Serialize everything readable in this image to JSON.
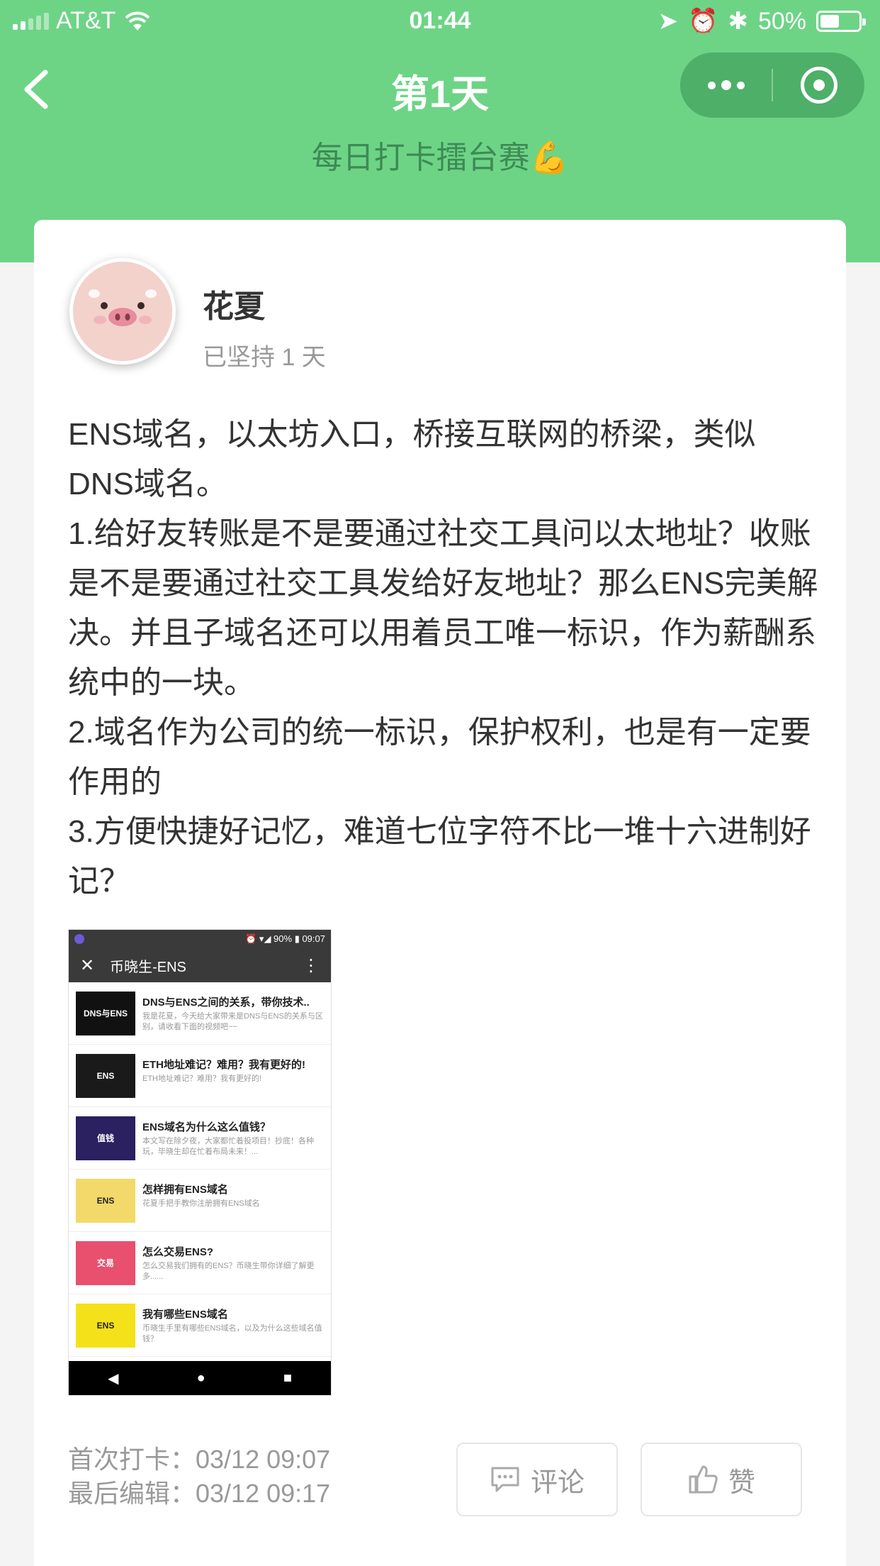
{
  "status_bar": {
    "carrier": "AT&T",
    "time": "01:44",
    "battery": "50%",
    "battery_level": 0.5
  },
  "nav": {
    "title": "第1天",
    "subtitle": "每日打卡擂台赛💪"
  },
  "post": {
    "username": "花夏",
    "persist": "已坚持 1 天",
    "content": "ENS域名，以太坊入口，桥接互联网的桥梁，类似DNS域名。\n1.给好友转账是不是要通过社交工具问以太地址？收账是不是要通过社交工具发给好友地址？那么ENS完美解决。并且子域名还可以用着员工唯一标识，作为薪酬系统中的一块。\n2.域名作为公司的统一标识，保护权利，也是有一定要作用的\n3.方便快捷好记忆，难道七位字符不比一堆十六进制好记？",
    "first_checkin": "首次打卡：03/12 09:07",
    "last_edit": "最后编辑：03/12 09:17",
    "comment_label": "评论",
    "like_label": "赞"
  },
  "screenshot": {
    "status": "⏰ ▾◢ 90% ▮ 09:07",
    "close": "✕",
    "title": "币晓生-ENS",
    "menu": "⋮",
    "items": [
      {
        "title": "DNS与ENS之间的关系，带你技术..",
        "desc": "我是花夏，今天给大家带来是DNS与ENS的关系与区别，请收看下面的视频吧~~",
        "thumb_color": "#111111",
        "thumb_text": "DNS与ENS"
      },
      {
        "title": "ETH地址难记？难用？我有更好的!",
        "desc": "ETH地址难记？难用？我有更好的!",
        "thumb_color": "#1a1a1a",
        "thumb_text": "ENS"
      },
      {
        "title": "ENS域名为什么这么值钱？",
        "desc": "本文写在除夕夜，大家都忙着投项目！抄底！各种玩，毕晓生却在忙着布局未来！...",
        "thumb_color": "#2b2060",
        "thumb_text": "值钱"
      },
      {
        "title": "怎样拥有ENS域名",
        "desc": "花夏手把手教你注册拥有ENS域名",
        "thumb_color": "#f3d96a",
        "thumb_text": "ENS"
      },
      {
        "title": "怎么交易ENS?",
        "desc": "怎么交易我们拥有的ENS？币晓生带你详细了解更多......",
        "thumb_color": "#e8506e",
        "thumb_text": "交易"
      },
      {
        "title": "我有哪些ENS域名",
        "desc": "币晓生手里有哪些ENS域名，以及为什么这些域名值钱？",
        "thumb_color": "#f5e11a",
        "thumb_text": "ENS"
      }
    ],
    "nav_back": "◀",
    "nav_home": "●",
    "nav_recent": "■"
  }
}
